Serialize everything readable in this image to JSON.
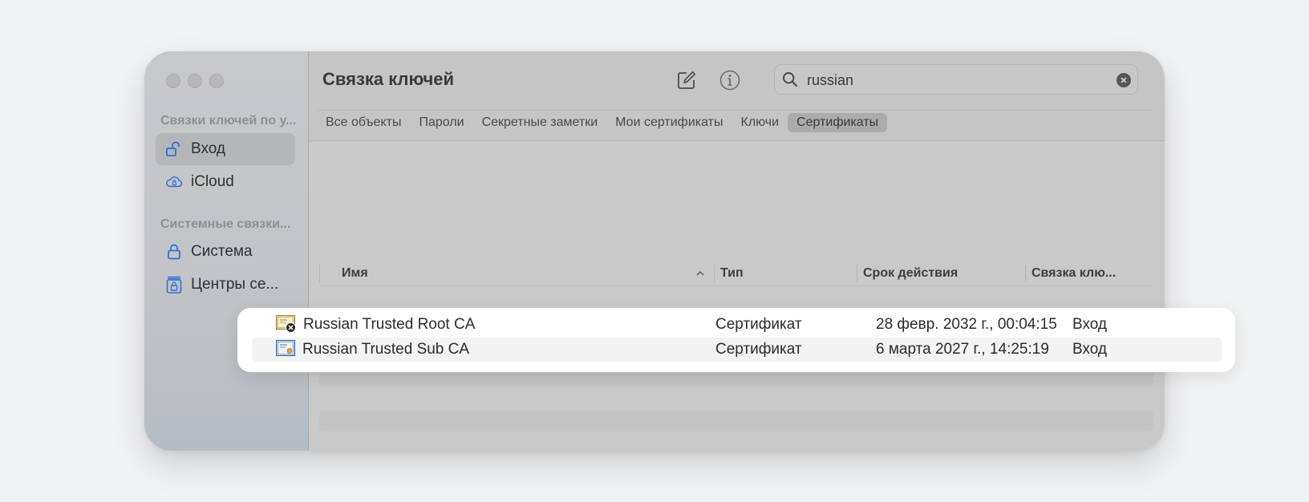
{
  "window": {
    "title": "Связка ключей",
    "traffic_lights": [
      "close",
      "minimize",
      "zoom"
    ]
  },
  "sidebar": {
    "section_1": "Связки ключей по у...",
    "items_1": [
      {
        "label": "Вход",
        "icon": "unlock-icon",
        "active": true
      },
      {
        "label": "iCloud",
        "icon": "cloud-icon",
        "active": false
      }
    ],
    "section_2": "Системные связки...",
    "items_2": [
      {
        "label": "Система",
        "icon": "lock-icon",
        "active": false
      },
      {
        "label": "Центры се...",
        "icon": "cabinet-lock-icon",
        "active": false
      }
    ]
  },
  "toolbar": {
    "compose_icon": "compose-icon",
    "info_icon": "info-icon"
  },
  "search": {
    "value": "russian",
    "icon": "search-icon",
    "clear_icon": "clear-icon"
  },
  "tabs": [
    {
      "label": "Все объекты",
      "active": false
    },
    {
      "label": "Пароли",
      "active": false
    },
    {
      "label": "Секретные заметки",
      "active": false
    },
    {
      "label": "Мои сертификаты",
      "active": false
    },
    {
      "label": "Ключи",
      "active": false
    },
    {
      "label": "Сертификаты",
      "active": true
    }
  ],
  "table": {
    "columns": [
      "Имя",
      "Тип",
      "Срок действия",
      "Связка клю..."
    ],
    "sort_column": "Имя",
    "sort_direction": "ascending",
    "rows": [
      {
        "name": "Russian Trusted Root CA",
        "type": "Сертификат",
        "expires": "28 февр. 2032 г., 00:04:15",
        "keychain": "Вход",
        "icon": "certificate-invalid-icon"
      },
      {
        "name": "Russian Trusted Sub CA",
        "type": "Сертификат",
        "expires": "6 марта 2027 г., 14:25:19",
        "keychain": "Вход",
        "icon": "certificate-icon"
      }
    ]
  },
  "colors": {
    "accent": "#2f6fd6",
    "window_dim": "#c9c9c9",
    "highlight_card": "#ffffff"
  }
}
